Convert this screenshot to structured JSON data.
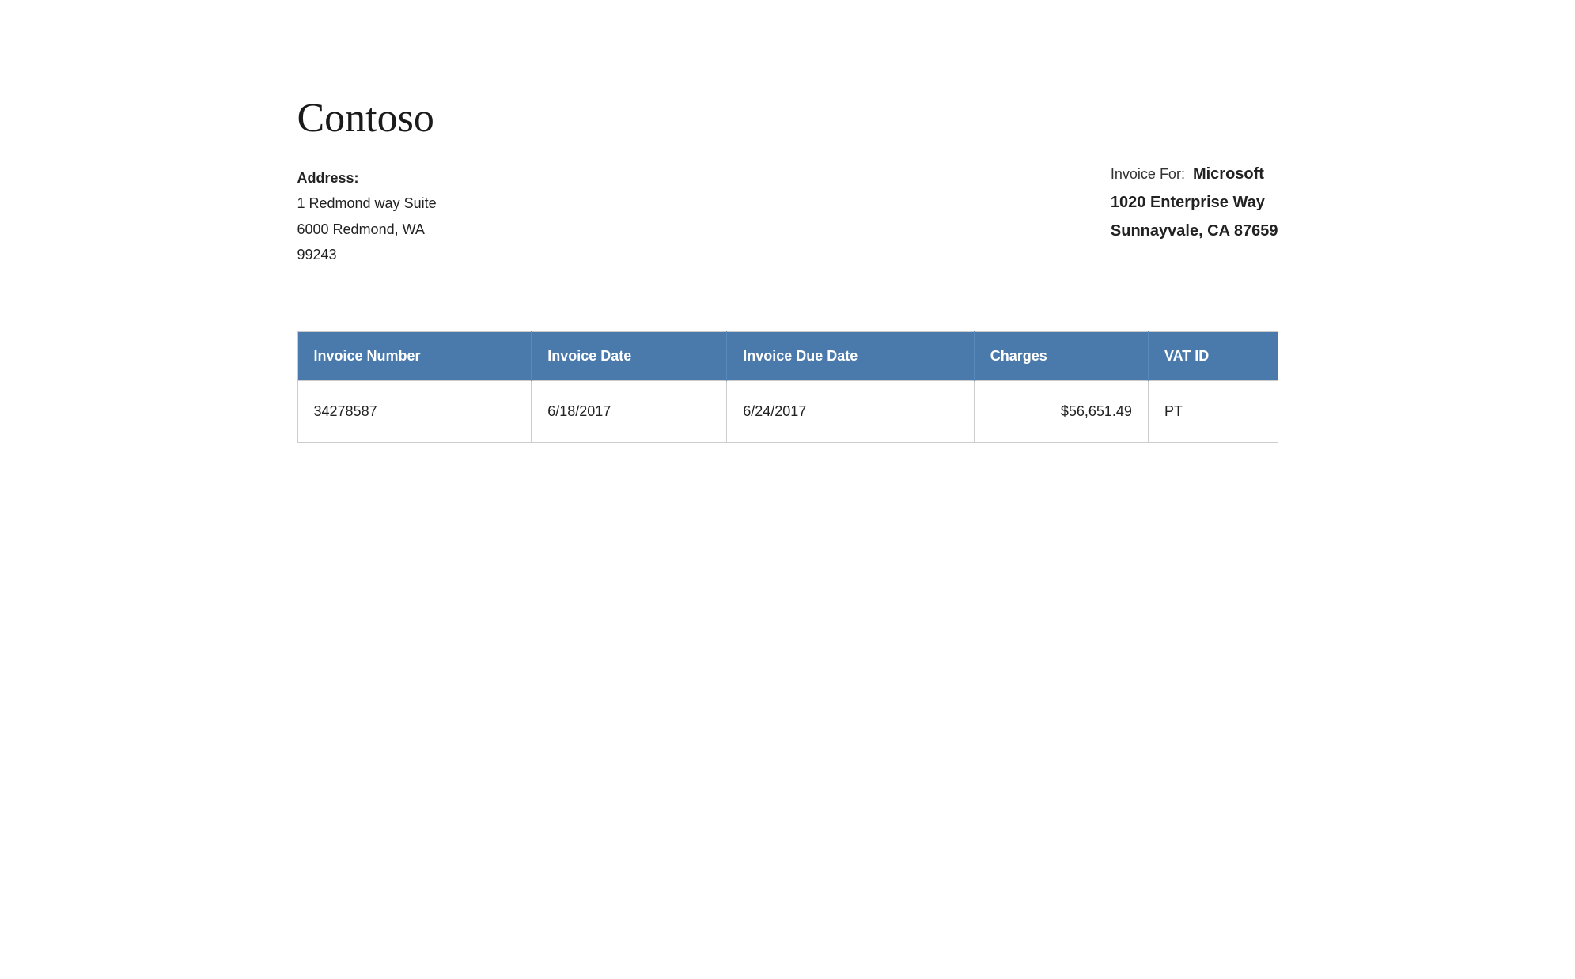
{
  "company": {
    "name": "Contoso"
  },
  "from_address": {
    "label": "Address:",
    "line1": "1 Redmond way Suite",
    "line2": "6000 Redmond, WA",
    "line3": "99243"
  },
  "invoice_for": {
    "label": "Invoice For:",
    "company": "Microsoft",
    "address_line1": "1020 Enterprise Way",
    "address_line2": "Sunnayvale, CA 87659"
  },
  "table": {
    "headers": [
      "Invoice Number",
      "Invoice Date",
      "Invoice Due Date",
      "Charges",
      "VAT ID"
    ],
    "rows": [
      {
        "invoice_number": "34278587",
        "invoice_date": "6/18/2017",
        "invoice_due_date": "6/24/2017",
        "charges": "$56,651.49",
        "vat_id": "PT"
      }
    ]
  }
}
